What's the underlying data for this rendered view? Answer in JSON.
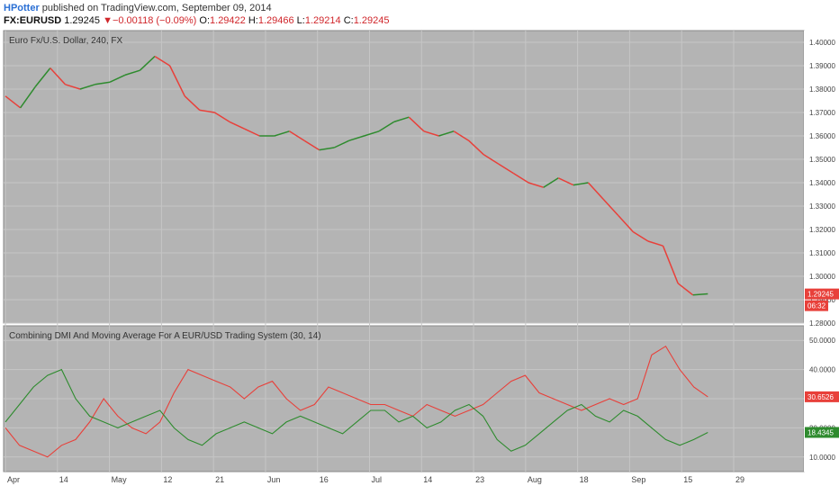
{
  "header": {
    "author": "HPotter",
    "published_text": "published on TradingView.com, September 09, 2014",
    "symbol": "FX:EURUSD",
    "last": "1.29245",
    "change_arrow": "▼",
    "change": "−0.00118 (−0.09%)",
    "open_label": "O:",
    "open": "1.29422",
    "high_label": "H:",
    "high": "1.29466",
    "low_label": "L:",
    "low": "1.29214",
    "close_label": "C:",
    "close": "1.29245"
  },
  "colors": {
    "pane_bg": "#b4b4b4",
    "grid": "#c6c6c6",
    "up": "#2e8b2e",
    "down": "#e8403a",
    "plus_di": "#2e8b2e",
    "minus_di": "#e8403a"
  },
  "chart_data": [
    {
      "type": "line",
      "title": "Euro Fx/U.S. Dollar, 240, FX",
      "ylim": [
        1.28,
        1.405
      ],
      "y_ticks": [
        "1.40000",
        "1.39000",
        "1.38000",
        "1.37000",
        "1.36000",
        "1.35000",
        "1.34000",
        "1.33000",
        "1.32000",
        "1.31000",
        "1.30000",
        "1.29000",
        "1.28000"
      ],
      "x_ticks": [
        "Apr",
        "14",
        "May",
        "12",
        "21",
        "Jun",
        "16",
        "Jul",
        "14",
        "23",
        "Aug",
        "18",
        "Sep",
        "15",
        "29"
      ],
      "last_price_label": "1.29245",
      "countdown_label": "06:32",
      "x": [
        "Apr 1",
        "Apr 4",
        "Apr 8",
        "Apr 11",
        "Apr 15",
        "Apr 18",
        "Apr 22",
        "Apr 25",
        "Apr 29",
        "May 2",
        "May 5",
        "May 8",
        "May 12",
        "May 15",
        "May 19",
        "May 22",
        "May 26",
        "May 29",
        "Jun 2",
        "Jun 5",
        "Jun 9",
        "Jun 12",
        "Jun 16",
        "Jun 19",
        "Jun 23",
        "Jun 26",
        "Jun 30",
        "Jul 3",
        "Jul 7",
        "Jul 10",
        "Jul 14",
        "Jul 17",
        "Jul 21",
        "Jul 24",
        "Jul 28",
        "Jul 31",
        "Aug 4",
        "Aug 7",
        "Aug 11",
        "Aug 14",
        "Aug 18",
        "Aug 21",
        "Aug 25",
        "Aug 28",
        "Sep 1",
        "Sep 4",
        "Sep 8",
        "Sep 9"
      ],
      "close": [
        1.377,
        1.372,
        1.381,
        1.389,
        1.382,
        1.38,
        1.382,
        1.383,
        1.386,
        1.388,
        1.394,
        1.39,
        1.377,
        1.371,
        1.37,
        1.366,
        1.363,
        1.36,
        1.36,
        1.362,
        1.358,
        1.354,
        1.355,
        1.358,
        1.36,
        1.362,
        1.366,
        1.368,
        1.362,
        1.36,
        1.362,
        1.358,
        1.352,
        1.348,
        1.344,
        1.34,
        1.338,
        1.342,
        1.339,
        1.34,
        1.333,
        1.326,
        1.319,
        1.315,
        1.313,
        1.297,
        1.292,
        1.2925
      ]
    },
    {
      "type": "line",
      "title": "Combining DMI And Moving Average For A EUR/USD Trading System (30, 14)",
      "ylim": [
        5,
        55
      ],
      "y_ticks": [
        "50.0000",
        "40.0000",
        "30.0000",
        "20.0000",
        "10.0000"
      ],
      "series": [
        {
          "values": [
            20,
            14,
            12,
            10,
            14,
            16,
            22,
            30,
            24,
            20,
            18,
            22,
            32,
            40,
            38,
            36,
            34,
            30,
            34,
            36,
            30,
            26,
            28,
            34,
            32,
            30,
            28,
            28,
            26,
            24,
            28,
            26,
            24,
            26,
            28,
            32,
            36,
            38,
            32,
            30,
            28,
            26,
            28,
            30,
            28,
            30,
            45,
            48,
            40,
            34,
            30.6526
          ]
        },
        {
          "values": [
            22,
            28,
            34,
            38,
            40,
            30,
            24,
            22,
            20,
            22,
            24,
            26,
            20,
            16,
            14,
            18,
            20,
            22,
            20,
            18,
            22,
            24,
            22,
            20,
            18,
            22,
            26,
            26,
            22,
            24,
            20,
            22,
            26,
            28,
            24,
            16,
            12,
            14,
            18,
            22,
            26,
            28,
            24,
            22,
            26,
            24,
            20,
            16,
            14,
            16,
            18.4345
          ]
        }
      ],
      "value_labels": [
        "30.6526",
        "18.4345"
      ]
    }
  ]
}
